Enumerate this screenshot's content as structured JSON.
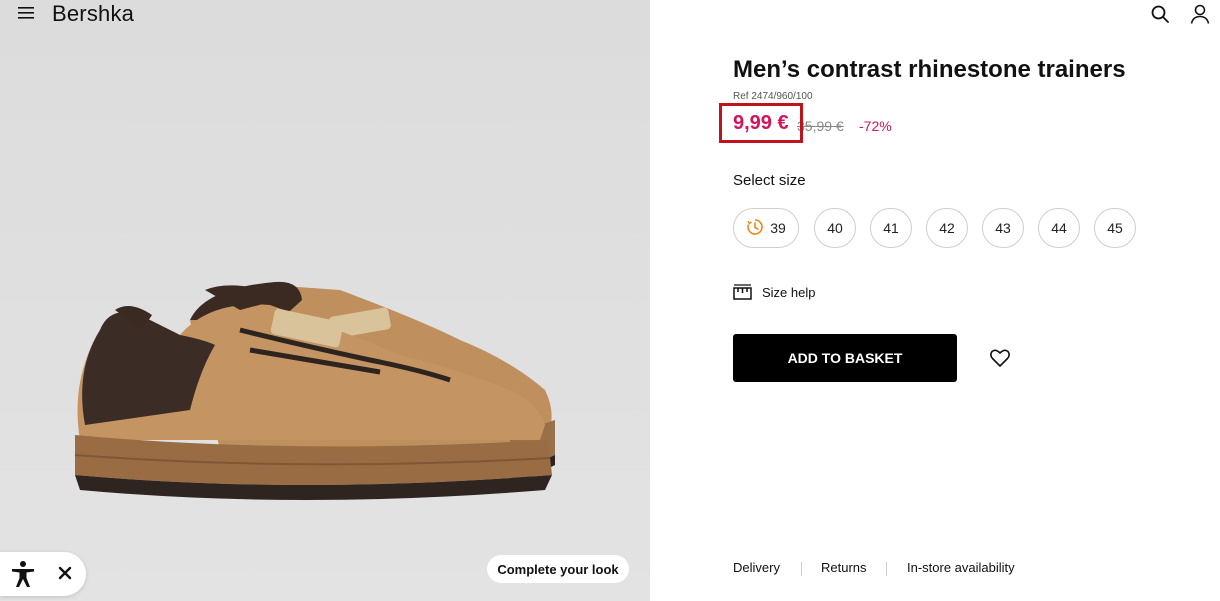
{
  "header": {
    "brand": "Bershka",
    "menu_icon": "hamburger-menu-icon",
    "search_icon": "search-icon",
    "account_icon": "user-icon"
  },
  "product": {
    "title": "Men’s contrast rhinestone trainers",
    "ref": "Ref 2474/960/100",
    "price_current": "9,99 €",
    "price_old": "35,99 €",
    "discount": "-72%",
    "select_size_label": "Select size",
    "sizes": [
      "39",
      "40",
      "41",
      "42",
      "43",
      "44",
      "45"
    ],
    "size_with_icon": "39",
    "size_help_label": "Size help",
    "add_to_basket_label": "ADD TO BASKET"
  },
  "image_panel": {
    "complete_look_label": "Complete your look"
  },
  "footer": {
    "links": [
      "Delivery",
      "Returns",
      "In-store availability"
    ]
  },
  "colors": {
    "accent_price": "#d4145a",
    "highlight_box": "#c0141c",
    "button_bg": "#000000",
    "image_bg": "#dedede"
  }
}
